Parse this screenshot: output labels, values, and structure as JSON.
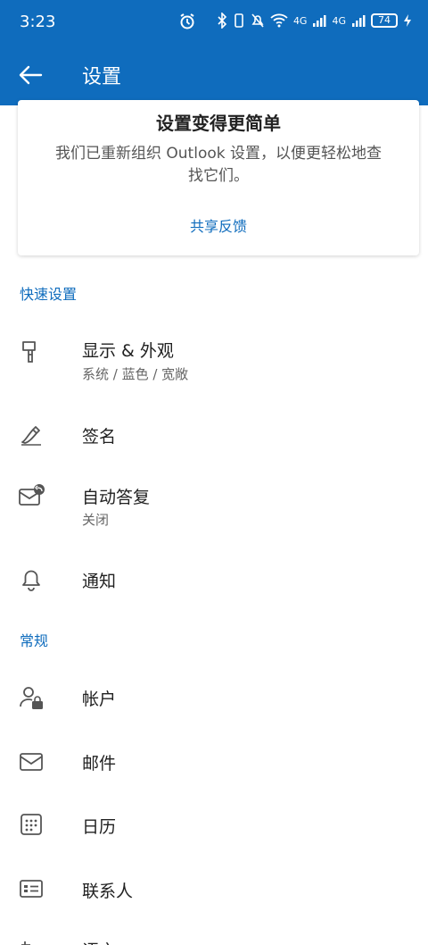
{
  "status": {
    "time": "3:23",
    "network_right": "4G",
    "battery": "74"
  },
  "appbar": {
    "title": "设置"
  },
  "banner": {
    "heading": "设置变得更简单",
    "description": "我们已重新组织 Outlook 设置，以便更轻松地查找它们。",
    "feedback": "共享反馈"
  },
  "sections": {
    "quick": "快速设置",
    "general": "常规"
  },
  "items": {
    "display": {
      "label": "显示 & 外观",
      "sub": "系统 / 蓝色 / 宽敞"
    },
    "signature": {
      "label": "签名"
    },
    "auto_reply": {
      "label": "自动答复",
      "sub": "关闭"
    },
    "notifications": {
      "label": "通知"
    },
    "accounts": {
      "label": "帐户"
    },
    "mail": {
      "label": "邮件"
    },
    "calendar": {
      "label": "日历"
    },
    "contacts": {
      "label": "联系人"
    },
    "language": {
      "label": "语言"
    }
  },
  "colors": {
    "brand": "#0f6cbd",
    "icon": "#555555"
  }
}
